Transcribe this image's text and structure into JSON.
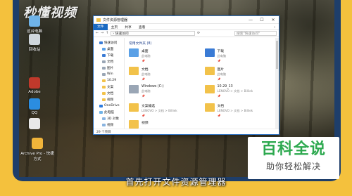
{
  "watermark": "秒懂视频",
  "subtitle": "首先打开文件资源管理器",
  "brand": {
    "name": "百科全说",
    "slogan": "助你轻松解决"
  },
  "desktop_icons": [
    {
      "label": "这台电脑",
      "color": "#6fb3e8"
    },
    {
      "label": "回收站",
      "color": "#cfd6dd"
    },
    {
      "label": "Adobe",
      "color": "#c0392b"
    },
    {
      "label": "QQ",
      "color": "#2b8de0"
    },
    {
      "label": "",
      "color": "#e8e8e8"
    },
    {
      "label": "Archive Pro - 快捷方式",
      "color": "#f0b43a"
    }
  ],
  "explorer": {
    "title": "文件资源管理器",
    "window_controls": {
      "minimize": "—",
      "maximize": "☐",
      "close": "✕"
    },
    "ribbon": [
      "文件",
      "主页",
      "共享",
      "查看"
    ],
    "ribbon_expand": "⌄",
    "address": {
      "back": "←",
      "forward": "→",
      "up": "↑",
      "path": "› 快速访问",
      "refresh": "⟳",
      "search_placeholder": "搜索\"快速访问\""
    },
    "nav": [
      {
        "label": "快速访问",
        "color": "#3a7bd5",
        "sub": false
      },
      {
        "label": "桌面",
        "color": "#5aa0e6",
        "sub": true
      },
      {
        "label": "下载",
        "color": "#3a7bd5",
        "sub": true
      },
      {
        "label": "文档",
        "color": "#9aa6b5",
        "sub": true
      },
      {
        "label": "图片",
        "color": "#9aa6b5",
        "sub": true
      },
      {
        "label": "Win",
        "color": "#9aa6b5",
        "sub": true
      },
      {
        "label": "10.29",
        "color": "#f2c24a",
        "sub": true
      },
      {
        "label": "文案",
        "color": "#f2c24a",
        "sub": true
      },
      {
        "label": "文档",
        "color": "#f2c24a",
        "sub": true
      },
      {
        "label": "视频",
        "color": "#f2c24a",
        "sub": true
      },
      {
        "label": "OneDrive",
        "color": "#2b7be0",
        "sub": false
      },
      {
        "label": "此电脑",
        "color": "#6fb3e8",
        "sub": false
      },
      {
        "label": "3D 对象",
        "color": "#8ab4e0",
        "sub": true
      },
      {
        "label": "视频",
        "color": "#8ab4e0",
        "sub": true
      },
      {
        "label": "图片",
        "color": "#8ab4e0",
        "sub": true
      },
      {
        "label": "文档",
        "color": "#8ab4e0",
        "sub": true
      },
      {
        "label": "下载",
        "color": "#3a7bd5",
        "sub": true
      },
      {
        "label": "音乐",
        "color": "#8ab4e0",
        "sub": true
      },
      {
        "label": "桌面",
        "color": "#5aa0e6",
        "sub": true
      }
    ],
    "section_title": "常用文件夹 (8)",
    "folders": [
      {
        "name": "桌面",
        "sub": "此电脑",
        "color": "#5aa0e6"
      },
      {
        "name": "下载",
        "sub": "此电脑",
        "color": "#3a7bd5"
      },
      {
        "name": "文档",
        "sub": "此电脑",
        "color": "#f2c24a"
      },
      {
        "name": "图片",
        "sub": "此电脑",
        "color": "#f2c24a"
      },
      {
        "name": "Windows (C:)",
        "sub": "此电脑",
        "color": "#9aa6b5"
      },
      {
        "name": "10.29_13",
        "sub": "LENOVO > 文档 > Billiek",
        "color": "#f2c24a"
      },
      {
        "name": "文案编选",
        "sub": "LENOVO > 文档 > Billiek",
        "color": "#f2c24a"
      },
      {
        "name": "文档",
        "sub": "LENOVO > 文档 > Billiek",
        "color": "#f2c24a"
      }
    ],
    "extra_item": "视频",
    "status": "29 个项目"
  }
}
